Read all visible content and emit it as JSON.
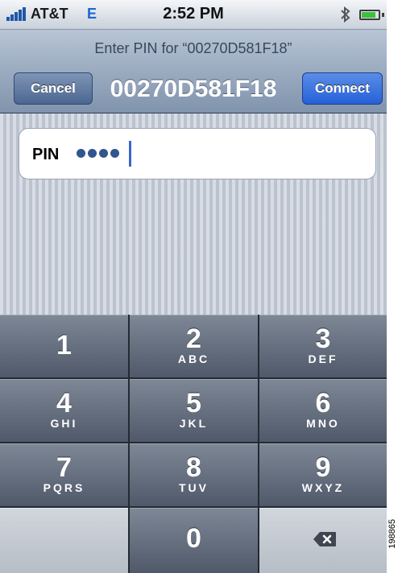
{
  "status_bar": {
    "carrier": "AT&T",
    "network": "E",
    "time": "2:52 PM",
    "icons": [
      "signal-icon",
      "bluetooth-icon",
      "battery-icon"
    ]
  },
  "nav": {
    "prompt": "Enter PIN for “00270D581F18”",
    "title": "00270D581F18",
    "cancel_label": "Cancel",
    "connect_label": "Connect"
  },
  "pin_field": {
    "label": "PIN",
    "masked_value": "●●●●"
  },
  "keypad": {
    "keys": [
      {
        "digit": "1",
        "letters": ""
      },
      {
        "digit": "2",
        "letters": "ABC"
      },
      {
        "digit": "3",
        "letters": "DEF"
      },
      {
        "digit": "4",
        "letters": "GHI"
      },
      {
        "digit": "5",
        "letters": "JKL"
      },
      {
        "digit": "6",
        "letters": "MNO"
      },
      {
        "digit": "7",
        "letters": "PQRS"
      },
      {
        "digit": "8",
        "letters": "TUV"
      },
      {
        "digit": "9",
        "letters": "WXYZ"
      },
      {
        "digit": "0",
        "letters": ""
      }
    ],
    "delete_icon": "backspace-icon"
  },
  "figure_code": "198865",
  "colors": {
    "accent": "#2660d8",
    "nav": "#8194ad",
    "keypad": "#4f5969"
  }
}
